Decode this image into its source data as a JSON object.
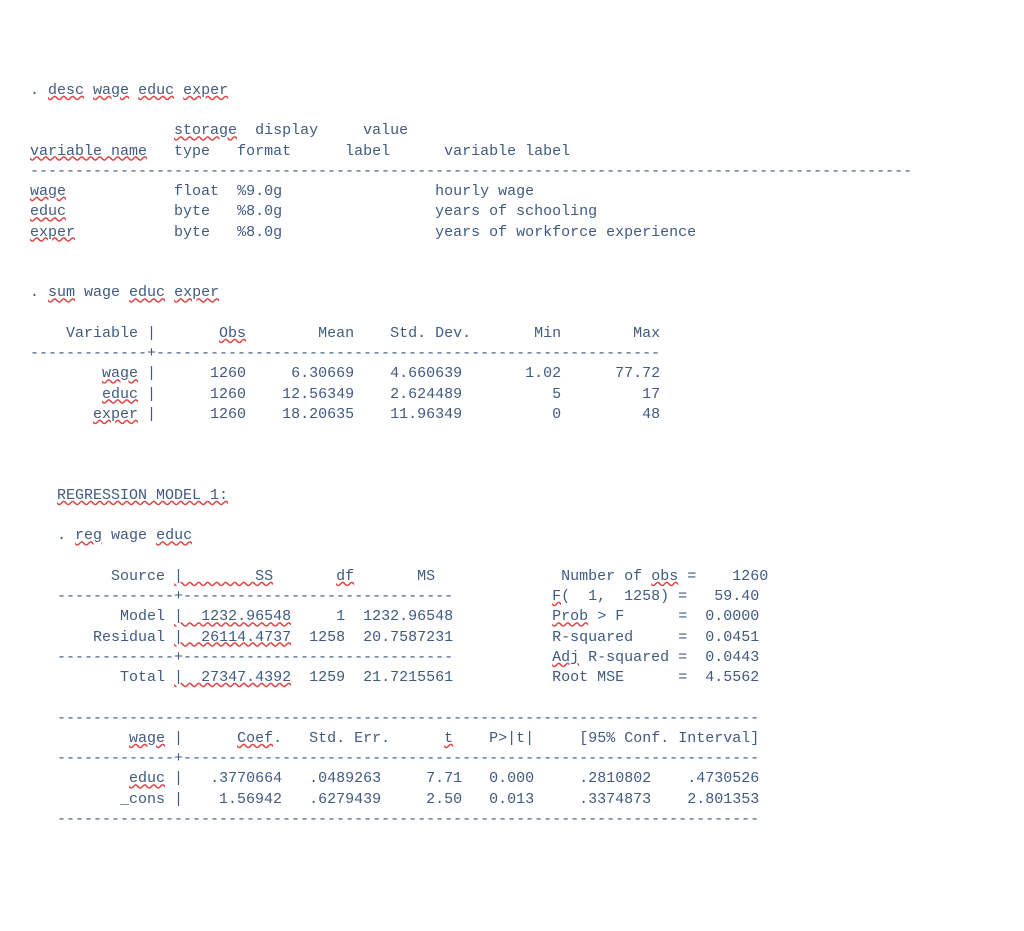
{
  "desc": {
    "cmd_prefix": ". ",
    "cmd": "desc",
    "args": [
      "wage",
      "educ",
      "exper"
    ],
    "header": {
      "c1": "variable name",
      "c2a": "storage",
      "c2b": "type",
      "c3a": "display",
      "c3b": "format",
      "c4a": "value",
      "c4b": "label",
      "c5": "variable label"
    },
    "rows": [
      {
        "name": "wage",
        "type": "float",
        "fmt": "%9.0g",
        "vallbl": "",
        "varlbl": "hourly wage"
      },
      {
        "name": "educ",
        "type": "byte",
        "fmt": "%8.0g",
        "vallbl": "",
        "varlbl": "years of schooling"
      },
      {
        "name": "exper",
        "type": "byte",
        "fmt": "%8.0g",
        "vallbl": "",
        "varlbl": "years of workforce experience"
      }
    ]
  },
  "sum": {
    "cmd_prefix": ". ",
    "cmd": "sum",
    "arg1": " wage ",
    "arg2": "educ",
    "arg3": " ",
    "arg4": "exper",
    "header": {
      "c1": "Variable",
      "c2": "Obs",
      "c3": "Mean",
      "c4": "Std. Dev.",
      "c5": "Min",
      "c6": "Max"
    },
    "rows": [
      {
        "name": "wage",
        "obs": "1260",
        "mean": "6.30669",
        "sd": "4.660639",
        "min": "1.02",
        "max": "77.72"
      },
      {
        "name": "educ",
        "obs": "1260",
        "mean": "12.56349",
        "sd": "2.624489",
        "min": "5",
        "max": "17"
      },
      {
        "name": "exper",
        "obs": "1260",
        "mean": "18.20635",
        "sd": "11.96349",
        "min": "0",
        "max": "48"
      }
    ]
  },
  "section_title": "REGRESSION MODEL 1:",
  "reg": {
    "cmd_prefix": ". ",
    "cmd": "reg",
    "arg1": " wage ",
    "arg2": "educ",
    "anova_header": {
      "c1": "Source",
      "c2": "SS",
      "c3": "df",
      "c4": "MS"
    },
    "anova": {
      "model": {
        "name": "Model",
        "ss": "1232.96548",
        "df": "1",
        "ms": "1232.96548"
      },
      "residual": {
        "name": "Residual",
        "ss": "26114.4737",
        "df": "1258",
        "ms": "20.7587231"
      },
      "total": {
        "name": "Total",
        "ss": "27347.4392",
        "df": "1259",
        "ms": "21.7215561"
      }
    },
    "stats": {
      "nobs_lbl": "Number of ",
      "nobs_lbl2": "obs",
      "nobs_eq": " =",
      "nobs": "1260",
      "F_lbl": "F",
      "F_paren": "(  1,  1258) =",
      "F": "59.40",
      "probF_lbl": "Prob",
      "probF_lbl2": " > F",
      "probF_eq": "=",
      "probF": "0.0000",
      "r2_lbl": "R-squared",
      "r2_eq": "=",
      "r2": "0.0451",
      "ar2_lbl": "Adj",
      "ar2_lbl2": " R-squared =",
      "ar2": "0.0443",
      "rmse_lbl": "Root MSE",
      "rmse_eq": "=",
      "rmse": "4.5562"
    },
    "coef_header": {
      "c1": "wage",
      "c2": "Coef",
      "c3": "Std. Err.",
      "c4": "t",
      "c5": "P>|t|",
      "c6": "[95% Conf. Interval]"
    },
    "coef": {
      "educ": {
        "name": "educ",
        "b": ".3770664",
        "se": ".0489263",
        "t": "7.71",
        "p": "0.000",
        "lo": ".2810802",
        "hi": ".4730526"
      },
      "cons": {
        "name": "_cons",
        "b": "1.56942",
        "se": ".6279439",
        "t": "2.50",
        "p": "0.013",
        "lo": ".3374873",
        "hi": "2.801353"
      }
    }
  },
  "chart_data": {
    "type": "table",
    "title": "Stata output: describe, summarize, regress",
    "describe": [
      {
        "variable": "wage",
        "storage_type": "float",
        "display_format": "%9.0g",
        "value_label": "",
        "variable_label": "hourly wage"
      },
      {
        "variable": "educ",
        "storage_type": "byte",
        "display_format": "%8.0g",
        "value_label": "",
        "variable_label": "years of schooling"
      },
      {
        "variable": "exper",
        "storage_type": "byte",
        "display_format": "%8.0g",
        "value_label": "",
        "variable_label": "years of workforce experience"
      }
    ],
    "summarize": [
      {
        "variable": "wage",
        "obs": 1260,
        "mean": 6.30669,
        "std_dev": 4.660639,
        "min": 1.02,
        "max": 77.72
      },
      {
        "variable": "educ",
        "obs": 1260,
        "mean": 12.56349,
        "std_dev": 2.624489,
        "min": 5,
        "max": 17
      },
      {
        "variable": "exper",
        "obs": 1260,
        "mean": 18.20635,
        "std_dev": 11.96349,
        "min": 0,
        "max": 48
      }
    ],
    "regression": {
      "depvar": "wage",
      "anova": {
        "model": {
          "SS": 1232.96548,
          "df": 1,
          "MS": 1232.96548
        },
        "residual": {
          "SS": 26114.4737,
          "df": 1258,
          "MS": 20.7587231
        },
        "total": {
          "SS": 27347.4392,
          "df": 1259,
          "MS": 21.7215561
        }
      },
      "stats": {
        "N": 1260,
        "F": 59.4,
        "F_df1": 1,
        "F_df2": 1258,
        "ProbF": 0.0,
        "R2": 0.0451,
        "AdjR2": 0.0443,
        "RootMSE": 4.5562
      },
      "coefficients": [
        {
          "var": "educ",
          "coef": 0.3770664,
          "std_err": 0.0489263,
          "t": 7.71,
          "p": 0.0,
          "ci95_lo": 0.2810802,
          "ci95_hi": 0.4730526
        },
        {
          "var": "_cons",
          "coef": 1.56942,
          "std_err": 0.6279439,
          "t": 2.5,
          "p": 0.013,
          "ci95_lo": 0.3374873,
          "ci95_hi": 2.801353
        }
      ]
    }
  }
}
